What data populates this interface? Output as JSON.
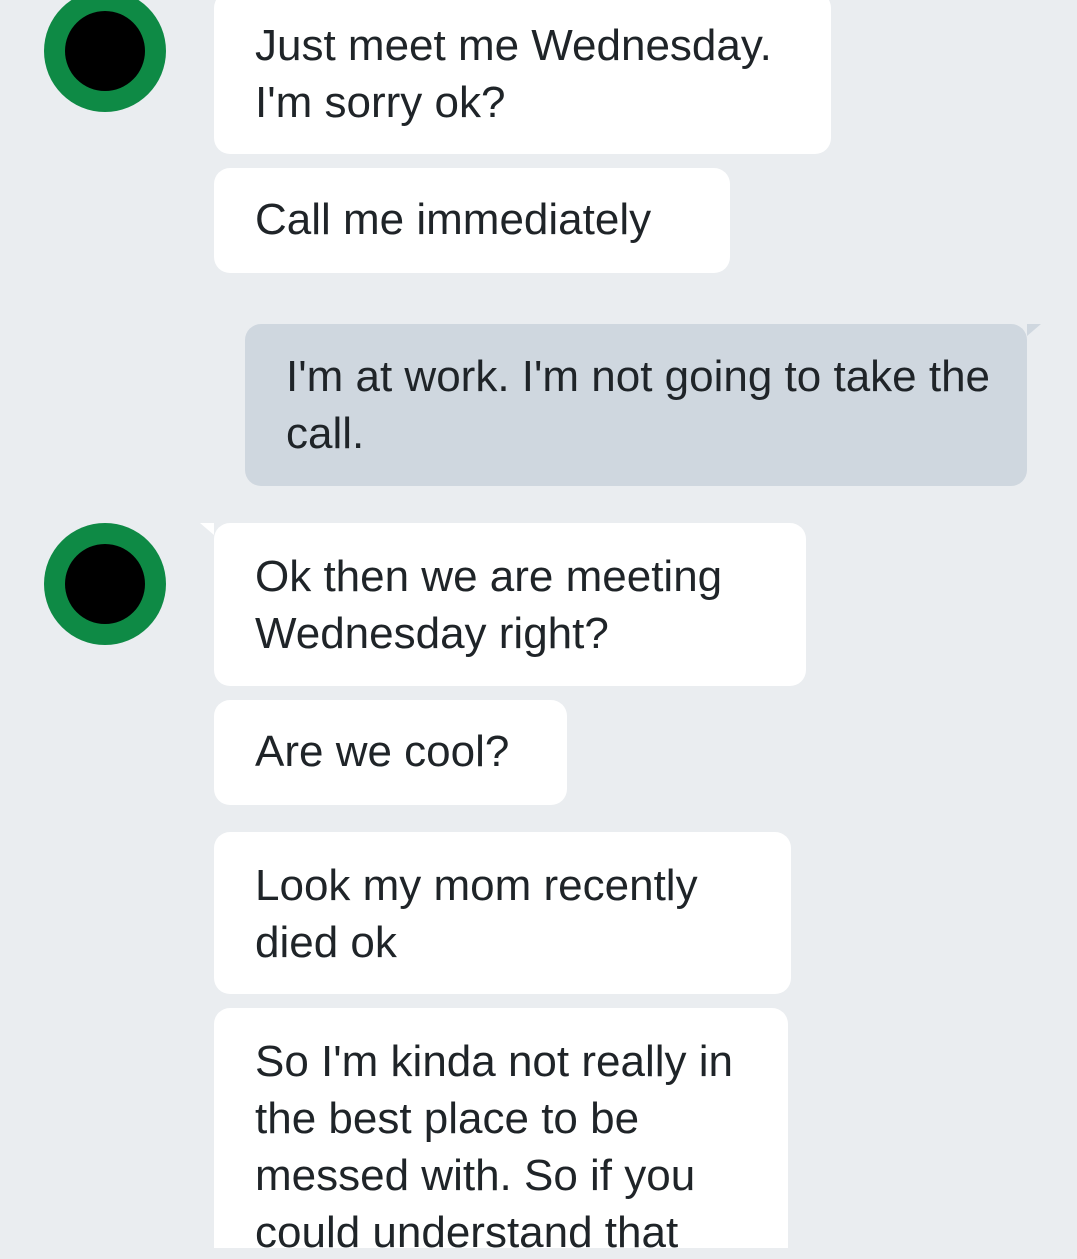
{
  "conversation": {
    "messages": [
      {
        "sender": "them",
        "text": "Just meet me Wednesday. I'm sorry ok?"
      },
      {
        "sender": "them",
        "text": "Call me immediately"
      },
      {
        "sender": "me",
        "text": "I'm at work. I'm not going to take the call."
      },
      {
        "sender": "them",
        "text": "Ok then we are meeting Wednesday right?"
      },
      {
        "sender": "them",
        "text": "Are we cool?"
      },
      {
        "sender": "them",
        "text": "Look my mom recently died ok"
      },
      {
        "sender": "them",
        "text": "So I'm kinda not really in the best place to be messed with. So if you could understand that"
      }
    ]
  },
  "colors": {
    "background": "#eaedf0",
    "incoming_bubble": "#ffffff",
    "outgoing_bubble": "#cfd7df",
    "avatar_ring": "#0e8a45",
    "avatar_center": "#000000",
    "text": "#1f2428"
  }
}
